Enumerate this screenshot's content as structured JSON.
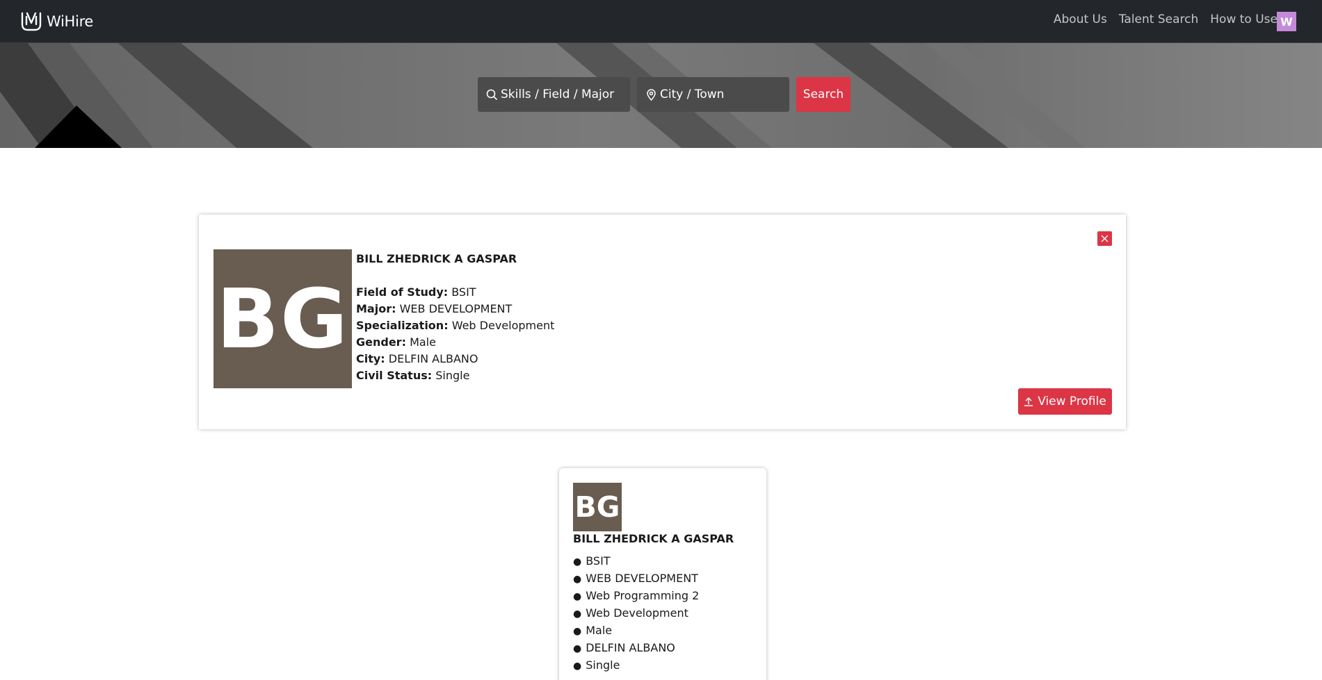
{
  "nav": {
    "brand": "WiHire",
    "links": [
      "About Us",
      "Talent Search",
      "How to Use"
    ],
    "user_initial": "W"
  },
  "search": {
    "skills_placeholder": "Skills / Field / Major",
    "city_placeholder": "City / Town",
    "button_label": "Search"
  },
  "detail": {
    "initials": "BG",
    "name": "BILL ZHEDRICK A GASPAR",
    "fields": [
      {
        "label": "Field of Study:",
        "value": "BSIT"
      },
      {
        "label": "Major:",
        "value": "WEB DEVELOPMENT"
      },
      {
        "label": "Specialization:",
        "value": "Web Development"
      },
      {
        "label": "Gender:",
        "value": "Male"
      },
      {
        "label": "City:",
        "value": "DELFIN ALBANO"
      },
      {
        "label": "Civil Status:",
        "value": "Single"
      }
    ],
    "view_profile_label": "View Profile"
  },
  "card": {
    "initials": "BG",
    "name": "BILL ZHEDRICK A GASPAR",
    "items": [
      "BSIT",
      "WEB DEVELOPMENT",
      "Web Programming 2",
      "Web Development",
      "Male",
      "DELFIN ALBANO",
      "Single"
    ]
  },
  "colors": {
    "navbar": "#23262b",
    "accent": "#dc3545",
    "avatar_bg": "#695c50",
    "user_avatar": "#c489d9"
  },
  "icons": {
    "brand": "wihire-logo-icon",
    "skills": "search-icon",
    "city": "location-pin-icon",
    "close": "close-icon",
    "view_profile": "upload-icon"
  }
}
